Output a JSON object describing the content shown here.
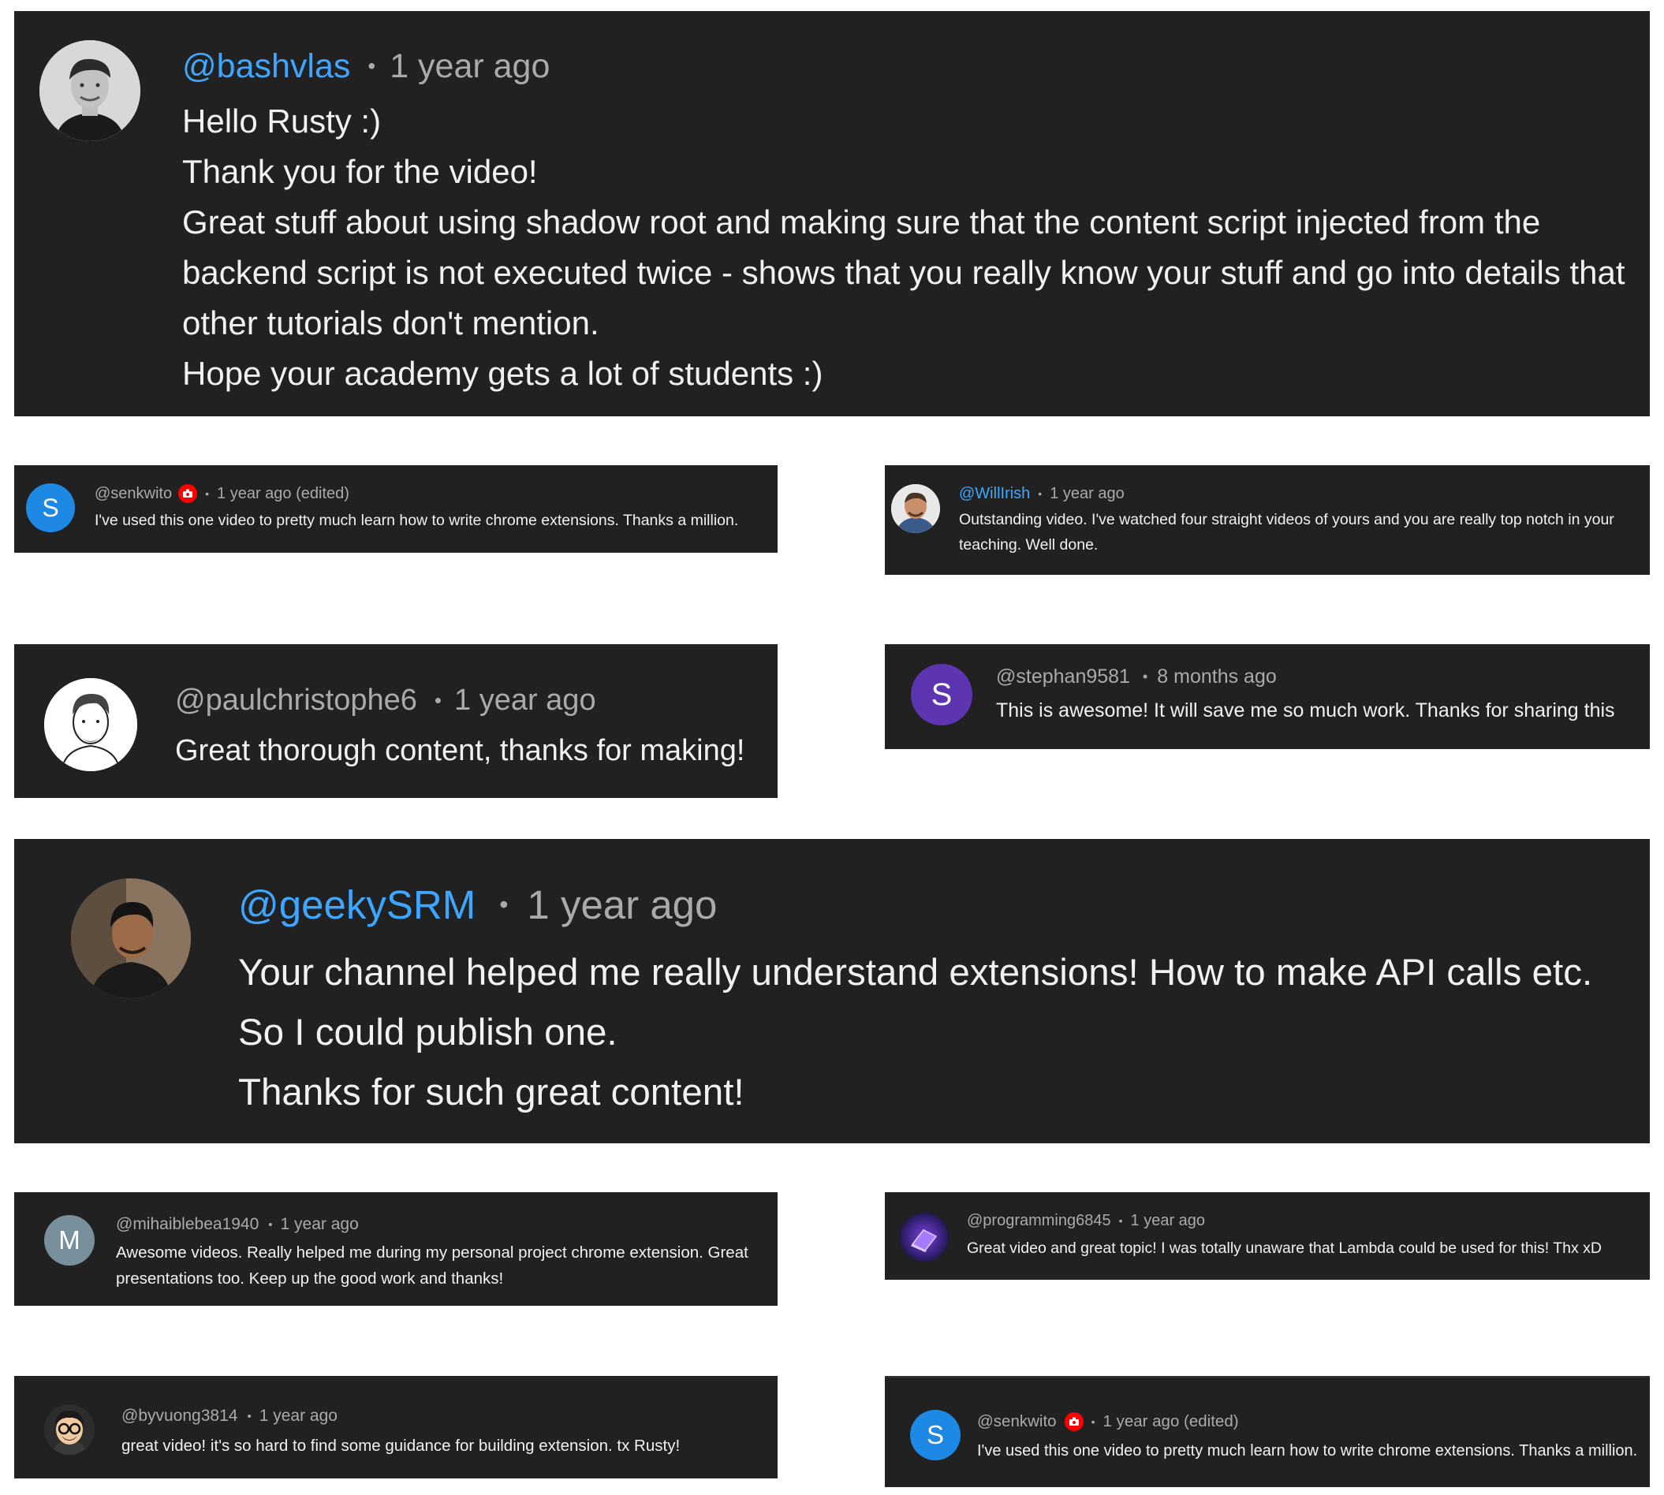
{
  "colors": {
    "card_bg": "#212121",
    "text_primary": "#f1f1f1",
    "text_secondary": "#aaaaaa",
    "handle_link": "#3ea6ff",
    "badge_red": "#ff0000"
  },
  "separator": "•",
  "comments": [
    {
      "handle": "@bashvlas",
      "time": "1 year ago",
      "avatar_icon": "portrait-photo",
      "lines": [
        "Hello Rusty :)",
        "Thank you for the video!",
        "Great stuff about using shadow root and making sure that the content script injected from the",
        "backend script is not executed twice - shows that you really know your stuff and go into details that",
        "other tutorials don't mention.",
        "Hope your academy gets a lot of students :)"
      ]
    },
    {
      "handle": "@senkwito",
      "time": "1 year ago (edited)",
      "avatar_letter": "S",
      "avatar_color": "#1e88e5",
      "badge_icon": "red-camera-badge-icon",
      "lines": [
        "I've used this one video to pretty much learn how to write chrome extensions. Thanks a million."
      ]
    },
    {
      "handle": "@WillIrish",
      "time": "1 year ago",
      "avatar_icon": "portrait-photo",
      "lines": [
        "Outstanding video. I've watched four straight videos of yours and you are really top notch in your",
        "teaching.  Well done."
      ]
    },
    {
      "handle": "@paulchristophe6",
      "time": "1 year ago",
      "avatar_icon": "sketch-portrait",
      "lines": [
        "Great thorough content, thanks for making!"
      ]
    },
    {
      "handle": "@stephan9581",
      "time": "8 months ago",
      "avatar_letter": "S",
      "avatar_color": "#5e35b1",
      "lines": [
        "This is awesome! It will save me so much work. Thanks for sharing this"
      ]
    },
    {
      "handle": "@geekySRM",
      "time": "1 year ago",
      "avatar_icon": "portrait-photo",
      "lines": [
        "Your channel helped me really understand extensions! How to make API calls etc.",
        "So I could publish one.",
        "Thanks for such great content!"
      ]
    },
    {
      "handle": "@mihaiblebea1940",
      "time": "1 year ago",
      "avatar_letter": "M",
      "avatar_color": "#78909c",
      "lines": [
        "Awesome videos. Really helped me during my personal project chrome extension. Great",
        "presentations too. Keep up the good work and thanks!"
      ]
    },
    {
      "handle": "@programming6845",
      "time": "1 year ago",
      "avatar_icon": "laptop-logo",
      "lines": [
        "Great video and great topic! I was totally unaware that Lambda could be used for this! Thx xD"
      ]
    },
    {
      "handle": "@byvuong3814",
      "time": "1 year ago",
      "avatar_icon": "memoji-glasses",
      "lines": [
        "great video! it's so hard to find some guidance for building extension. tx Rusty!"
      ]
    },
    {
      "handle": "@senkwito",
      "time": "1 year ago (edited)",
      "avatar_letter": "S",
      "avatar_color": "#1e88e5",
      "badge_icon": "red-camera-badge-icon",
      "lines": [
        "I've used this one video to pretty much learn how to write chrome extensions. Thanks a million."
      ]
    }
  ]
}
